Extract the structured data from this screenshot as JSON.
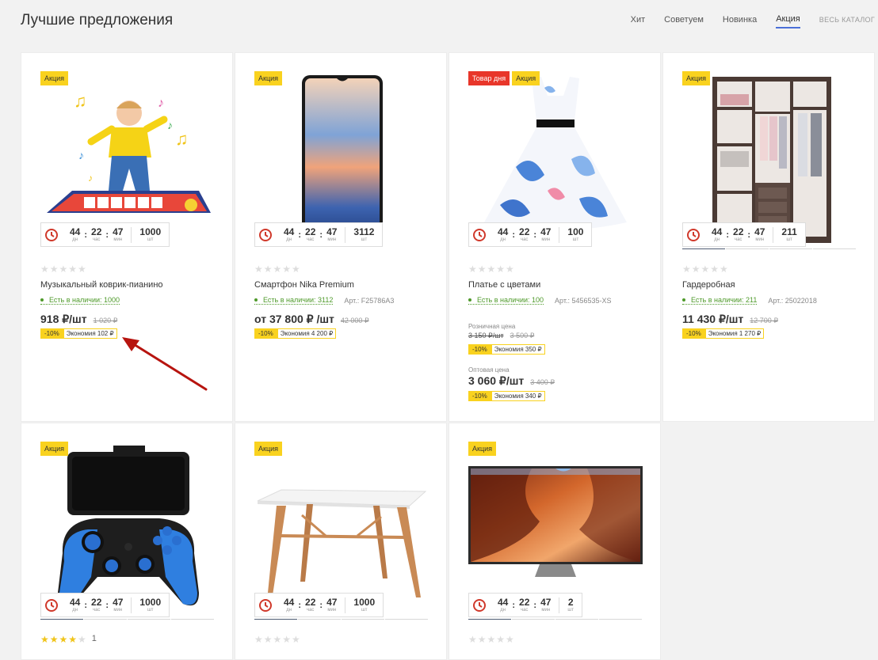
{
  "header": {
    "title": "Лучшие предложения",
    "tabs": [
      "Хит",
      "Советуем",
      "Новинка",
      "Акция"
    ],
    "active_tab": "Акция",
    "all_link": "ВЕСЬ КАТАЛОГ"
  },
  "colors": {
    "accent": "#4a6fd8",
    "badge_sale": "#f9d21f",
    "badge_day": "#e8362a",
    "stock": "#4e9a2a",
    "timer_icon": "#d0392b"
  },
  "timer_labels": {
    "days": "дн",
    "hours": "час",
    "minutes": "мин",
    "pieces": "шт"
  },
  "products": [
    {
      "badges": [
        "Акция"
      ],
      "timer": {
        "days": "44",
        "hours": "22",
        "minutes": "47",
        "qty": "1000"
      },
      "rating": 0,
      "name": "Музыкальный коврик-пианино",
      "stock": "Есть в наличии: 1000",
      "price": "918 ₽/шт",
      "old_price": "1 020 ₽",
      "discount": "-10%",
      "saving": "Экономия 102 ₽",
      "image": "music-mat"
    },
    {
      "badges": [
        "Акция"
      ],
      "timer": {
        "days": "44",
        "hours": "22",
        "minutes": "47",
        "qty": "3112"
      },
      "rating": 0,
      "name": "Смартфон Nika Premium",
      "stock": "Есть в наличии: 3112",
      "article": "Арт.: F25786A3",
      "price": "от 37 800 ₽ /шт",
      "old_price": "42 000 ₽",
      "discount": "-10%",
      "saving": "Экономия 4 200 ₽",
      "image": "smartphone"
    },
    {
      "badges": [
        "Товар дня",
        "Акция"
      ],
      "timer": {
        "days": "44",
        "hours": "22",
        "minutes": "47",
        "qty": "100"
      },
      "rating": 0,
      "name": "Платье с цветами",
      "stock": "Есть в наличии: 100",
      "article": "Арт.: 5456535-XS",
      "retail_label": "Розничная цена",
      "retail_price": "3 150 ₽/шт",
      "retail_old": "3 500 ₽",
      "retail_discount": "-10%",
      "retail_saving": "Экономия 350 ₽",
      "wholesale_label": "Оптовая цена",
      "price": "3 060 ₽/шт",
      "old_price": "3 400 ₽",
      "discount": "-10%",
      "saving": "Экономия 340 ₽",
      "image": "dress"
    },
    {
      "badges": [
        "Акция"
      ],
      "timer": {
        "days": "44",
        "hours": "22",
        "minutes": "47",
        "qty": "211"
      },
      "rating": 0,
      "name": "Гардеробная",
      "stock": "Есть в наличии: 211",
      "article": "Арт.: 25022018",
      "price": "11 430 ₽/шт",
      "old_price": "12 700 ₽",
      "discount": "-10%",
      "saving": "Экономия 1 270 ₽",
      "image": "wardrobe"
    },
    {
      "badges": [
        "Акция"
      ],
      "timer": {
        "days": "44",
        "hours": "22",
        "minutes": "47",
        "qty": "1000"
      },
      "rating": 4,
      "reviews": "1",
      "image": "gamepad"
    },
    {
      "badges": [
        "Акция"
      ],
      "timer": {
        "days": "44",
        "hours": "22",
        "minutes": "47",
        "qty": "1000"
      },
      "rating": 0,
      "image": "table"
    },
    {
      "badges": [
        "Акция"
      ],
      "timer": {
        "days": "44",
        "hours": "22",
        "minutes": "47",
        "qty": "2"
      },
      "rating": 0,
      "image": "tv"
    }
  ]
}
